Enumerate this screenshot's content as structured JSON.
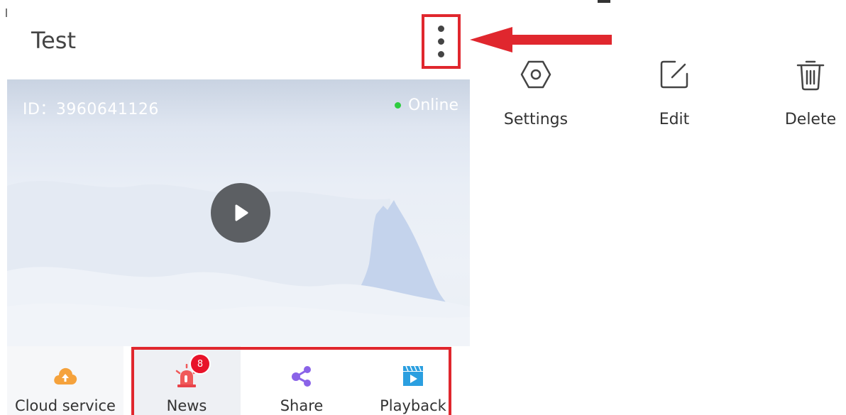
{
  "header": {
    "title": "Test"
  },
  "video": {
    "device_id": "ID：3960641126",
    "status": "Online",
    "status_color": "#2ecc40"
  },
  "nav": {
    "items": [
      {
        "label": "Cloud service",
        "icon": "cloud-upload-icon"
      },
      {
        "label": "News",
        "icon": "alarm-siren-icon",
        "badge": "8"
      },
      {
        "label": "Share",
        "icon": "share-icon"
      },
      {
        "label": "Playback",
        "icon": "playback-icon"
      }
    ]
  },
  "menu": {
    "items": [
      {
        "label": "Settings",
        "icon": "hexagon-settings-icon"
      },
      {
        "label": "Edit",
        "icon": "edit-icon"
      },
      {
        "label": "Delete",
        "icon": "trash-icon"
      }
    ]
  },
  "colors": {
    "highlight": "#e0272e",
    "arrow": "#e0272e",
    "accent_orange": "#f5a23c",
    "accent_purple": "#8a63e8",
    "accent_blue": "#2b9fe0",
    "badge": "#e8132a"
  }
}
